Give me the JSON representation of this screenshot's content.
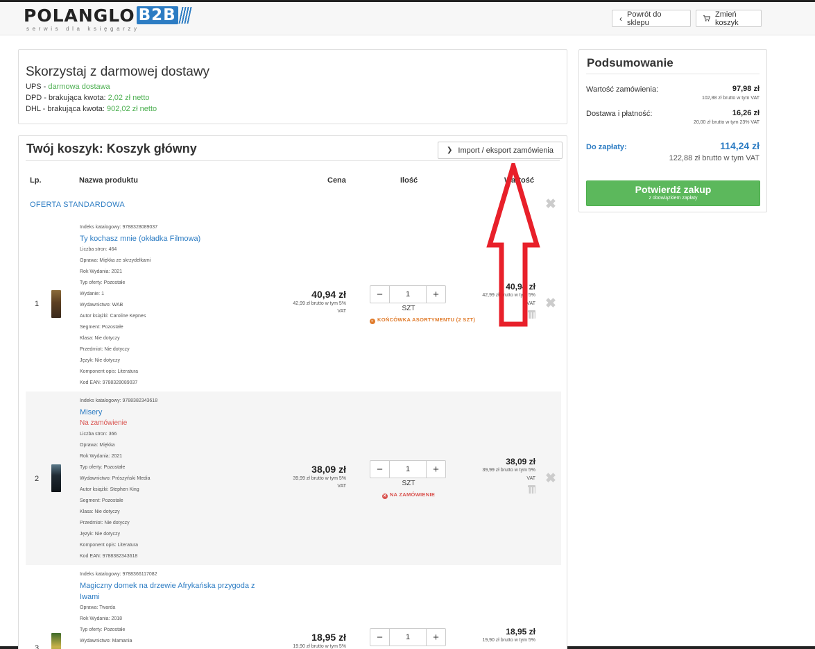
{
  "header": {
    "logo_main": "POLANGLO",
    "logo_b2b": "B2B",
    "logo_tagline": "serwis dla księgarzy",
    "back_label": "Powrót do sklepu",
    "change_cart_label": "Zmień koszyk"
  },
  "delivery": {
    "title": "Skorzystaj z darmowej dostawy",
    "lines": [
      {
        "carrier": "UPS - ",
        "text": "",
        "value": "darmowa dostawa"
      },
      {
        "carrier": "DPD - ",
        "text": "brakująca kwota: ",
        "value": "2,02 zł netto"
      },
      {
        "carrier": "DHL - ",
        "text": "brakująca kwota: ",
        "value": "902,02 zł netto"
      }
    ]
  },
  "cart": {
    "title": "Twój koszyk: Koszyk główny",
    "import_export_label": "Import / eksport zamówienia",
    "columns": {
      "lp": "Lp.",
      "name": "Nazwa produktu",
      "price": "Cena",
      "qty": "Ilość",
      "value": "Wartość"
    },
    "section_title": "OFERTA STANDARDOWA",
    "items": [
      {
        "lp": "1",
        "catalog": "Indeks katalogowy: 9788328089037",
        "title": "Ty kochasz mnie (okładka Filmowa)",
        "status": "",
        "details": [
          "Liczba stron: 464",
          "Oprawa: Miękka ze skrzydełkami",
          "Rok Wydania: 2021",
          "Typ oferty: Pozostałe",
          "Wydanie: 1",
          "Wydawnictwo: WAB",
          "Autor książki: Caroline Kepnes",
          "Segment: Pozostałe",
          "Klasa: Nie dotyczy",
          "Przedmiot: Nie dotyczy",
          "Język: Nie dotyczy",
          "Komponent opis: Literatura",
          "Kod EAN: 9788328089037"
        ],
        "price": "40,94 zł",
        "price_sub1": "42,99 zł brutto w tym 5%",
        "price_sub2": "VAT",
        "qty": "1",
        "unit": "SZT",
        "notice": "KOŃCÓWKA ASORTYMENTU (2 SZT)",
        "value": "40,94 zł",
        "value_sub1": "42,99 zł brutto w tym 5%",
        "value_sub2": "VAT"
      },
      {
        "lp": "2",
        "catalog": "Indeks katalogowy: 9788382343618",
        "title": "Misery",
        "status": "Na zamówienie",
        "details": [
          "Liczba stron: 366",
          "Oprawa: Miękka",
          "Rok Wydania: 2021",
          "Typ oferty: Pozostałe",
          "Wydawnictwo: Prószyński Media",
          "Autor książki: Stephen King",
          "Segment: Pozostałe",
          "Klasa: Nie dotyczy",
          "Przedmiot: Nie dotyczy",
          "Język: Nie dotyczy",
          "Komponent opis: Literatura",
          "Kod EAN: 9788382343618"
        ],
        "price": "38,09 zł",
        "price_sub1": "39,99 zł brutto w tym 5%",
        "price_sub2": "VAT",
        "qty": "1",
        "unit": "SZT",
        "notice": "NA ZAMÓWIENIE",
        "value": "38,09 zł",
        "value_sub1": "39,99 zł brutto w tym 5%",
        "value_sub2": "VAT"
      },
      {
        "lp": "3",
        "catalog": "Indeks katalogowy: 9788366117082",
        "title": "Magiczny domek na drzewie Afrykańska przygoda z Iwami",
        "status": "",
        "details": [
          "Oprawa: Twarda",
          "Rok Wydania: 2018",
          "Typ oferty: Pozostałe",
          "Wydawnictwo: Mamania"
        ],
        "price": "18,95 zł",
        "price_sub1": "19,90 zł brutto w tym 5%",
        "qty": "1",
        "value": "18,95 zł",
        "value_sub1": "19,90 zł brutto w tym 5%"
      }
    ]
  },
  "summary": {
    "title": "Podsumowanie",
    "order_value_label": "Wartość zamówienia:",
    "order_value": "97,98 zł",
    "order_value_sub": "102,88 zł brutto w tym VAT",
    "shipping_label": "Dostawa i płatność:",
    "shipping_value": "16,26 zł",
    "shipping_sub": "20,00 zł brutto w tym 23% VAT",
    "pay_label": "Do zapłaty:",
    "pay_value": "114,24 zł",
    "pay_sub": "122,88 zł brutto w tym VAT",
    "confirm_label": "Potwierdź zakup",
    "confirm_sub": "z obowiązkiem zapłaty"
  },
  "colors": {
    "accent": "#2c7cc3",
    "green": "#5cb85c",
    "annotation": "#e8202a"
  }
}
